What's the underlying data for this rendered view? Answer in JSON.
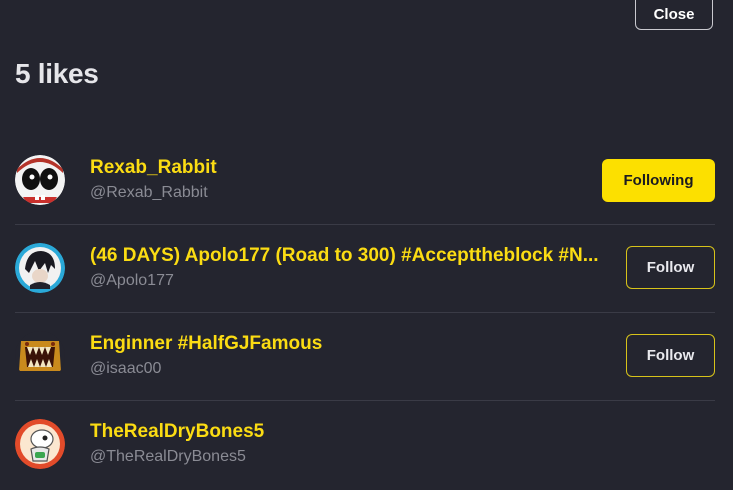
{
  "dialog": {
    "close_label": "Close",
    "title": "5 likes"
  },
  "users": [
    {
      "name": "Rexab_Rabbit",
      "handle": "@Rexab_Rabbit",
      "button": "Following",
      "avatar": "cartoon-rabbit-avatar"
    },
    {
      "name": "(46 DAYS) Apolo177 (Road to 300) #Accepttheblock #N...",
      "handle": "@Apolo177",
      "button": "Follow",
      "avatar": "anime-character-avatar"
    },
    {
      "name": "Enginner #HalfGJFamous",
      "handle": "@isaac00",
      "button": "Follow",
      "avatar": "monster-mouth-avatar"
    },
    {
      "name": "TheRealDryBones5",
      "handle": "@TheRealDryBones5",
      "button": "",
      "avatar": "dry-bones-avatar"
    }
  ],
  "colors": {
    "background": "#24252f",
    "accent_yellow": "#fce000",
    "name_yellow": "#fbdc13",
    "handle_gray": "#8a8b94"
  }
}
